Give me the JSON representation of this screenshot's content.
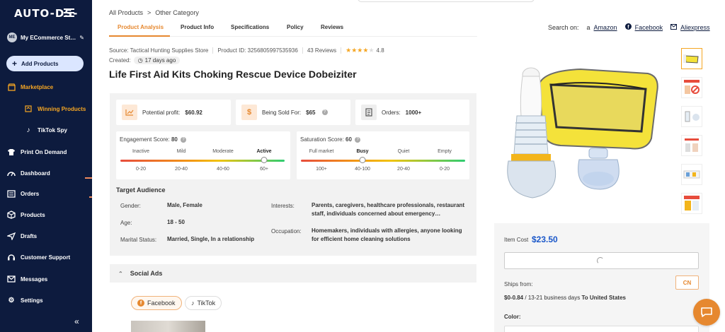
{
  "sidebar": {
    "logo": "AUTO-DS-",
    "store_initials": "ME",
    "store_name": "My ECommerce St…",
    "add_products": "Add Products",
    "marketplace": "Marketplace",
    "winning_products": "Winning Products",
    "tiktok_spy": "TikTok Spy",
    "print_on_demand": "Print On Demand",
    "dashboard": "Dashboard",
    "orders": "Orders",
    "products": "Products",
    "drafts": "Drafts",
    "customer_support": "Customer Support",
    "messages": "Messages",
    "settings": "Settings"
  },
  "breadcrumb": {
    "root": "All Products",
    "sep": ">",
    "current": "Other Category"
  },
  "tabs": [
    "Product Analysis",
    "Product Info",
    "Specifications",
    "Policy",
    "Reviews"
  ],
  "search_on": {
    "label": "Search on:",
    "amazon": "Amazon",
    "facebook": "Facebook",
    "aliexpress": "Aliexpress"
  },
  "meta": {
    "source": "Source: Tactical Hunting Supplies Store",
    "product_id": "Product ID: 3256805997535936",
    "reviews": "43 Reviews",
    "rating": "4.8",
    "rating_value": 4.8,
    "created_label": "Created:",
    "created_value": "17 days ago"
  },
  "product_title": "Life First Aid Kits Choking Rescue Device Dobeiziter",
  "stats": {
    "profit_label": "Potential profit:",
    "profit_value": "$60.92",
    "sold_label": "Being Sold For:",
    "sold_value": "$65",
    "orders_label": "Orders:",
    "orders_value": "1000+"
  },
  "engagement": {
    "label": "Engagement Score:",
    "score": "80",
    "levels": [
      "Inactive",
      "Mild",
      "Moderate",
      "Active"
    ],
    "ranges": [
      "0-20",
      "20-40",
      "40-60",
      "60+"
    ],
    "active_index": 3
  },
  "saturation": {
    "label": "Saturation Score:",
    "score": "60",
    "levels": [
      "Full market",
      "Busy",
      "Quiet",
      "Empty"
    ],
    "ranges": [
      "100+",
      "40-100",
      "20-40",
      "0-20"
    ],
    "active_index": 1
  },
  "audience": {
    "title": "Target Audience",
    "gender_label": "Gender:",
    "gender": "Male, Female",
    "age_label": "Age:",
    "age": "18 - 50",
    "marital_label": "Marital Status:",
    "marital": "Married, Single, In a relationship",
    "interests_label": "Interests:",
    "interests_1": "Parents, caregivers, healthcare professionals, restaurant",
    "interests_2": "staff, individuals concerned about emergency…",
    "occupation_label": "Occupation:",
    "occupation_1": "Homemakers, individuals with allergies, anyone looking",
    "occupation_2": "for efficient home cleaning solutions"
  },
  "social": {
    "title": "Social Ads",
    "facebook": "Facebook",
    "tiktok": "TikTok"
  },
  "buy": {
    "item_cost_label": "Item Cost",
    "item_cost": "$23.50",
    "ships_from_label": "Ships from:",
    "ships_from_value": "CN",
    "shipping_price": "$0-0.84",
    "shipping_days": "/ 13-21 business days",
    "shipping_to": "To United States",
    "color_label": "Color:"
  },
  "colors": {
    "accent": "#e6882f",
    "sidebar": "#0d1b3e",
    "price": "#1a57c9"
  }
}
